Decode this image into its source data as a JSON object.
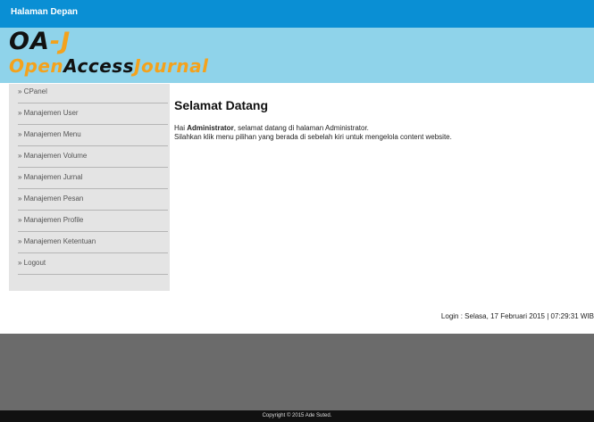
{
  "topbar": {
    "home_link": "Halaman Depan"
  },
  "logo": {
    "line1_main": "OA",
    "line1_accent": "-J",
    "line2_accent": "Open",
    "line2_dark": "Access",
    "line2_accent2": "Journal"
  },
  "sidebar": {
    "items": [
      {
        "label": "» CPanel"
      },
      {
        "label": "» Manajemen User"
      },
      {
        "label": "» Manajemen Menu"
      },
      {
        "label": "» Manajemen Volume"
      },
      {
        "label": "» Manajemen Jurnal"
      },
      {
        "label": "» Manajemen Pesan"
      },
      {
        "label": "» Manajemen Profile"
      },
      {
        "label": "» Manajemen Ketentuan"
      },
      {
        "label": "» Logout"
      }
    ]
  },
  "main": {
    "title": "Selamat Datang",
    "greeting_prefix": "Hai ",
    "user_name": "Administrator",
    "greeting_suffix": ", selamat datang di halaman Administrator.",
    "instruction": "Silahkan klik menu pilihan yang berada di sebelah kiri untuk mengelola content website."
  },
  "status": {
    "login": "Login : Selasa, 17 Februari 2015 | 07:29:31 WIB"
  },
  "footer": {
    "copyright": "Copyright © 2015 Ade Suted."
  },
  "colors": {
    "topbar": "#0a8fd4",
    "banner": "#8fd3ea",
    "logo_accent": "#f4a21c",
    "sidebar": "#e4e4e4",
    "gray_panel": "#6b6b6b",
    "footer": "#111111"
  }
}
